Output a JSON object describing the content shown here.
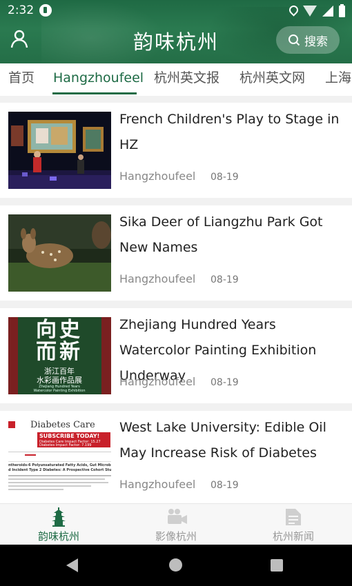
{
  "status_bar": {
    "time": "2:32",
    "icons": [
      "app-notification-icon",
      "location-icon",
      "wifi-icon",
      "signal-icon",
      "battery-icon"
    ]
  },
  "header": {
    "title": "韵味杭州",
    "search_label": "搜索",
    "left_icon": "user-icon",
    "color": "#1f6a44"
  },
  "tabs": [
    {
      "label": "首页",
      "active": false
    },
    {
      "label": "Hangzhoufeel",
      "active": true
    },
    {
      "label": "杭州英文报",
      "active": false
    },
    {
      "label": "杭州英文网",
      "active": false
    },
    {
      "label": "上海",
      "active": false
    }
  ],
  "articles": [
    {
      "title": "French Children's Play to Stage in HZ",
      "source": "Hangzhoufeel",
      "date": "08-19",
      "thumb": "stage-performance"
    },
    {
      "title": "Sika Deer of Liangzhu Park Got New Names",
      "source": "Hangzhoufeel",
      "date": "08-19",
      "thumb": "deer"
    },
    {
      "title": "Zhejiang Hundred Years Watercolor Painting Exhibition Underway",
      "source": "Hangzhoufeel",
      "date": "08-19",
      "thumb": "exhibition-poster"
    },
    {
      "title": "West Lake University: Edible Oil May Increase Risk of Diabetes",
      "source": "Hangzhoufeel",
      "date": "08-19",
      "thumb": "journal-page"
    }
  ],
  "thumbs": {
    "poster_line1": "向史",
    "poster_line2": "而新",
    "poster_sub1": "浙江百年",
    "poster_sub2": "水彩画作品展",
    "poster_sub3": "Zhejiang Hundred Years",
    "poster_sub4": "Watercolor Painting Exhibition",
    "journal_name": "Diabetes Care",
    "journal_banner": "SUBSCRIBE TODAY!",
    "journal_banner2": "Diabetes Care Impact Factor: 15.27",
    "journal_banner3": "Diabetes Impact Factor: 7.199",
    "journal_heading1": "ntheroids-6 Polyunsaturated Fatty Acids, Gut Microbio",
    "journal_heading2": "d Incident Type 2 Diabetes: A Prospective Cohort Study"
  },
  "bottom_nav": [
    {
      "label": "韵味杭州",
      "icon": "pagoda-icon",
      "active": true
    },
    {
      "label": "影像杭州",
      "icon": "video-camera-icon",
      "active": false
    },
    {
      "label": "杭州新闻",
      "icon": "document-icon",
      "active": false
    }
  ],
  "colors": {
    "accent": "#1e6b45",
    "separator": "#f1f1f1",
    "inactive": "#999999"
  }
}
